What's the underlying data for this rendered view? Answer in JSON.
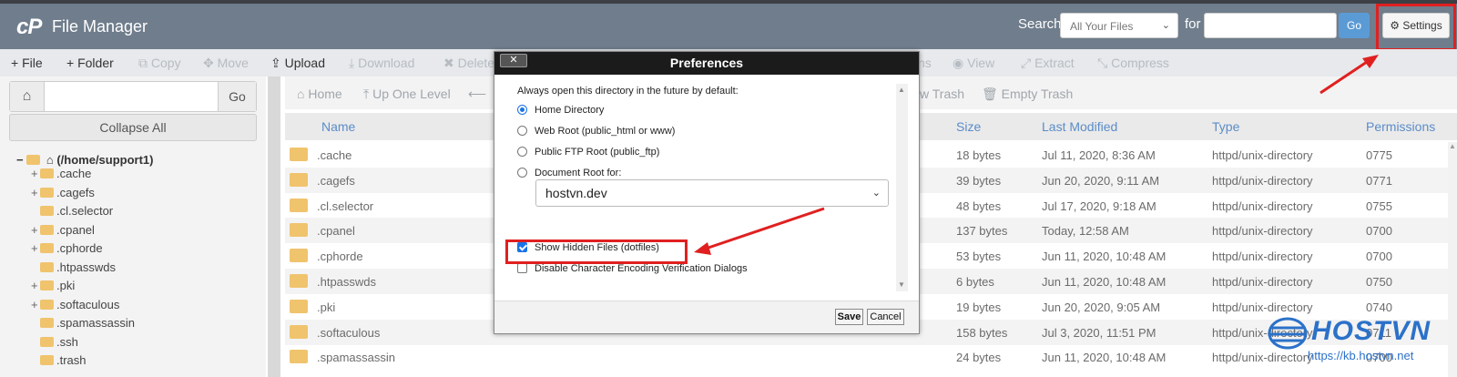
{
  "header": {
    "logo": "cP",
    "title": "File Manager",
    "search_label": "Search",
    "search_scope": "All Your Files",
    "for_label": "for",
    "search_value": "",
    "go_label": "Go",
    "settings_label": "Settings"
  },
  "toolbar": {
    "items": [
      {
        "label": "File",
        "icon": "+",
        "enabled": true
      },
      {
        "label": "Folder",
        "icon": "+",
        "enabled": true
      },
      {
        "label": "Copy",
        "icon": "⧉",
        "enabled": false
      },
      {
        "label": "Move",
        "icon": "✥",
        "enabled": false
      },
      {
        "label": "Upload",
        "icon": "⇪",
        "enabled": true
      },
      {
        "label": "Download",
        "icon": "⤓",
        "enabled": false
      },
      {
        "label": "Delete",
        "icon": "✖",
        "enabled": false
      },
      {
        "label": "View",
        "icon": "◉",
        "enabled": false
      },
      {
        "label": "Extract",
        "icon": "⤢",
        "enabled": false
      },
      {
        "label": "Compress",
        "icon": "⤡",
        "enabled": false
      }
    ],
    "partial_item": "ns"
  },
  "sidebar": {
    "path_value": "",
    "go_label": "Go",
    "collapse_label": "Collapse All",
    "root_label": "(/home/support1)",
    "tree": [
      {
        "label": ".cache",
        "expandable": true
      },
      {
        "label": ".cagefs",
        "expandable": true
      },
      {
        "label": ".cl.selector",
        "expandable": false
      },
      {
        "label": ".cpanel",
        "expandable": true
      },
      {
        "label": ".cphorde",
        "expandable": true
      },
      {
        "label": ".htpasswds",
        "expandable": false
      },
      {
        "label": ".pki",
        "expandable": true
      },
      {
        "label": ".softaculous",
        "expandable": true
      },
      {
        "label": ".spamassassin",
        "expandable": false
      },
      {
        "label": ".ssh",
        "expandable": false
      },
      {
        "label": ".trash",
        "expandable": false
      }
    ]
  },
  "navbar": {
    "home": "Home",
    "up_one_level": "Up One Level",
    "back": "",
    "view_trash": "w Trash",
    "empty_trash": "Empty Trash"
  },
  "table": {
    "columns": [
      "Name",
      "Size",
      "Last Modified",
      "Type",
      "Permissions"
    ],
    "rows": [
      {
        "name": ".cache",
        "size": "18 bytes",
        "modified": "Jul 11, 2020, 8:36 AM",
        "type": "httpd/unix-directory",
        "perms": "0775"
      },
      {
        "name": ".cagefs",
        "size": "39 bytes",
        "modified": "Jun 20, 2020, 9:11 AM",
        "type": "httpd/unix-directory",
        "perms": "0771"
      },
      {
        "name": ".cl.selector",
        "size": "48 bytes",
        "modified": "Jul 17, 2020, 9:18 AM",
        "type": "httpd/unix-directory",
        "perms": "0755"
      },
      {
        "name": ".cpanel",
        "size": "137 bytes",
        "modified": "Today, 12:58 AM",
        "type": "httpd/unix-directory",
        "perms": "0700"
      },
      {
        "name": ".cphorde",
        "size": "53 bytes",
        "modified": "Jun 11, 2020, 10:48 AM",
        "type": "httpd/unix-directory",
        "perms": "0700"
      },
      {
        "name": ".htpasswds",
        "size": "6 bytes",
        "modified": "Jun 11, 2020, 10:48 AM",
        "type": "httpd/unix-directory",
        "perms": "0750"
      },
      {
        "name": ".pki",
        "size": "19 bytes",
        "modified": "Jun 20, 2020, 9:05 AM",
        "type": "httpd/unix-directory",
        "perms": "0740"
      },
      {
        "name": ".softaculous",
        "size": "158 bytes",
        "modified": "Jul 3, 2020, 11:51 PM",
        "type": "httpd/unix-directory",
        "perms": "0711"
      },
      {
        "name": ".spamassassin",
        "size": "24 bytes",
        "modified": "Jun 11, 2020, 10:48 AM",
        "type": "httpd/unix-directory",
        "perms": "0700"
      }
    ]
  },
  "dialog": {
    "title": "Preferences",
    "close_label": "✕",
    "intro": "Always open this directory in the future by default:",
    "options": [
      {
        "label": "Home Directory",
        "selected": true
      },
      {
        "label": "Web Root (public_html or www)",
        "selected": false
      },
      {
        "label": "Public FTP Root (public_ftp)",
        "selected": false
      },
      {
        "label": "Document Root for:",
        "selected": false
      }
    ],
    "domain_value": "hostvn.dev",
    "show_hidden_label": "Show Hidden Files (dotfiles)",
    "show_hidden_checked": true,
    "disable_encoding_label": "Disable Character Encoding Verification Dialogs",
    "disable_encoding_checked": false,
    "save_label": "Save",
    "cancel_label": "Cancel"
  },
  "watermark": {
    "brand": "HOSTVN",
    "url": "https://kb.hostvn.net"
  },
  "colors": {
    "header_bg": "#6f7d8c",
    "highlight_red": "#e02020",
    "link_blue": "#5b8cc8",
    "go_button": "#5b9bd5",
    "folder": "#f0c36d"
  }
}
